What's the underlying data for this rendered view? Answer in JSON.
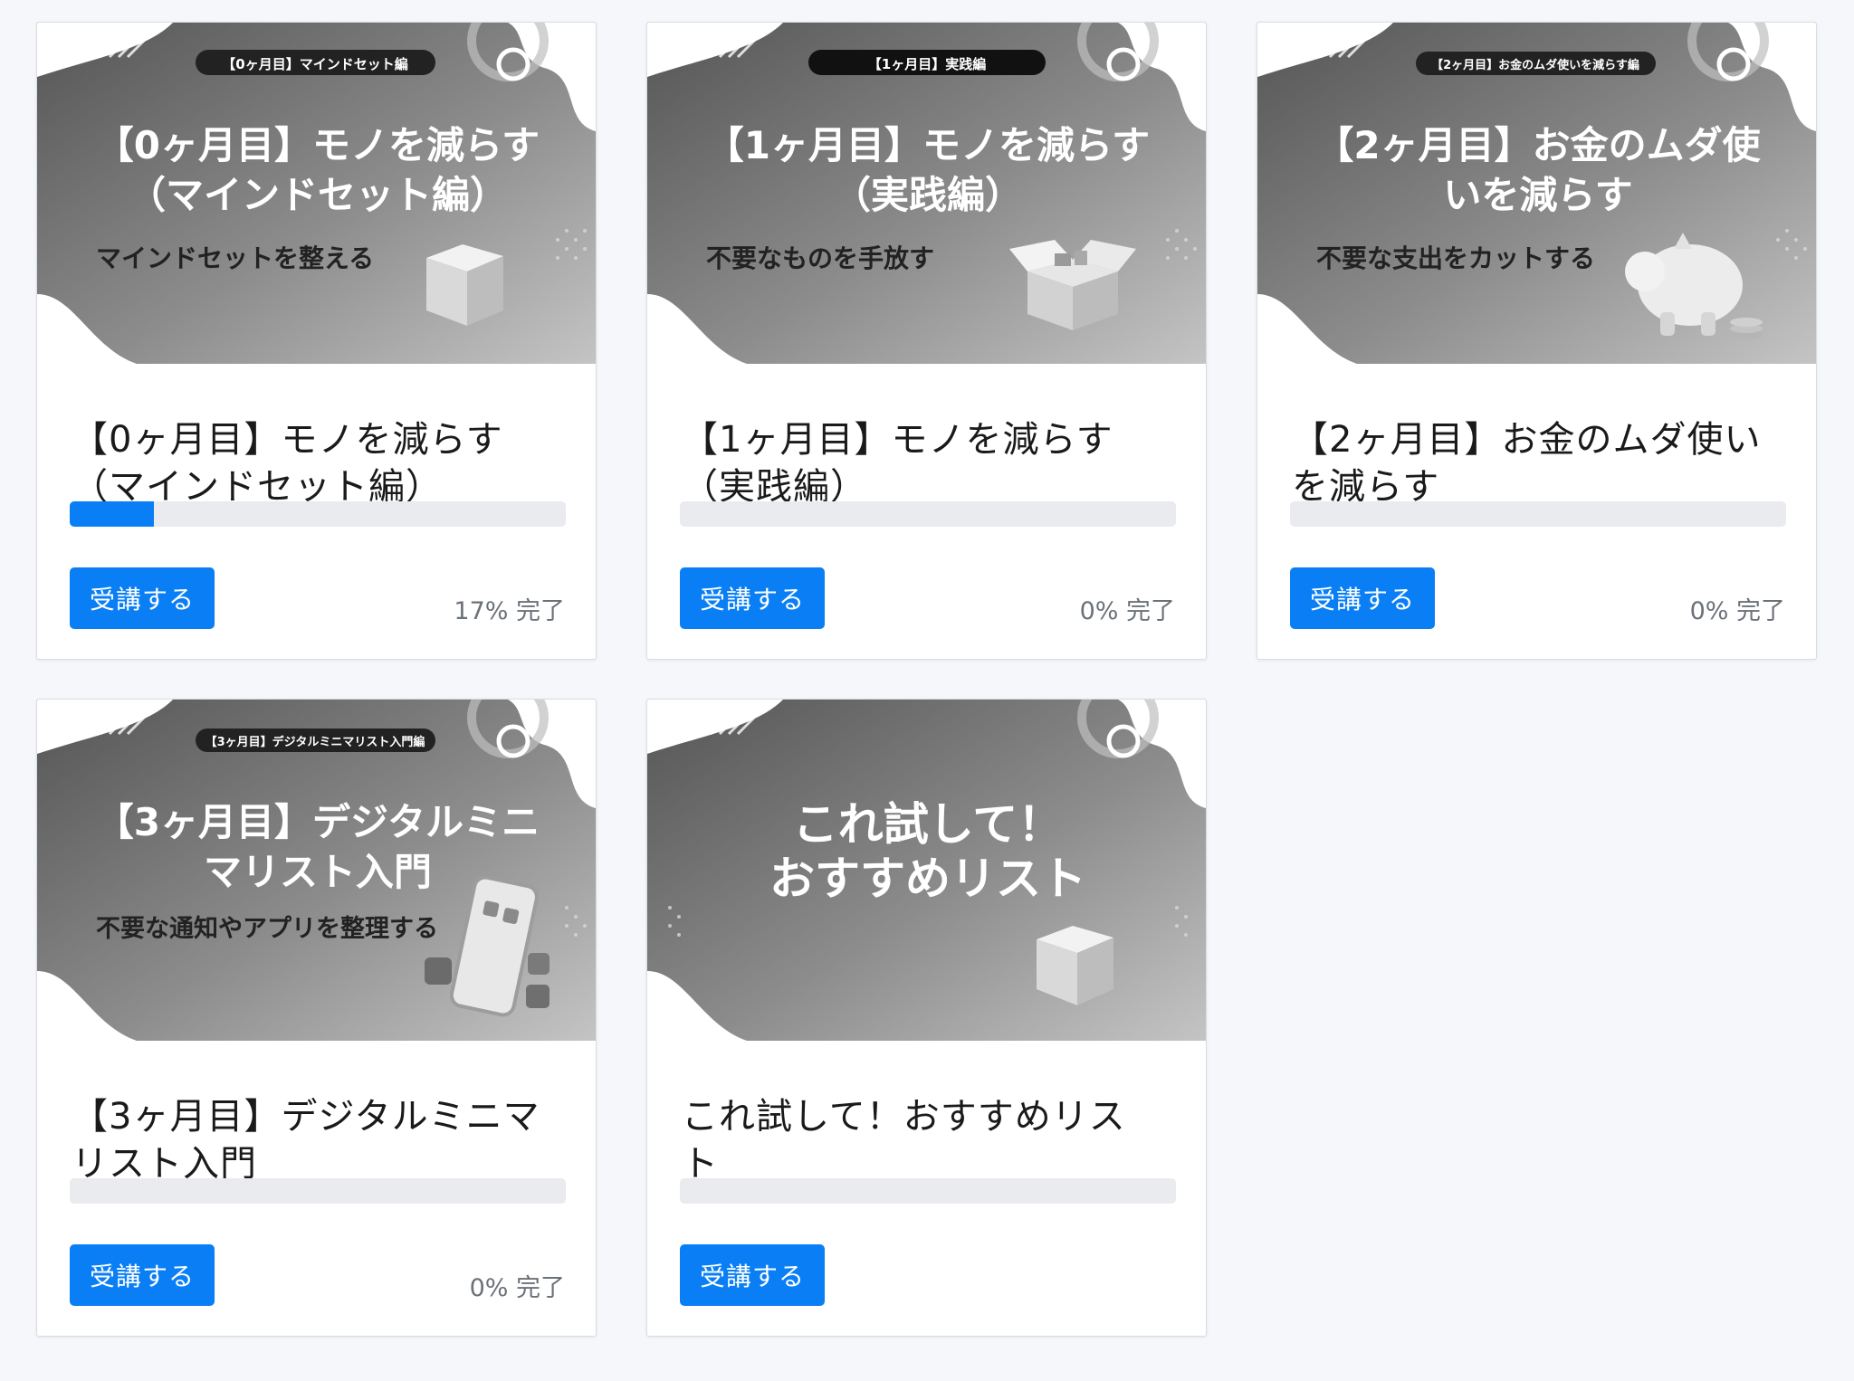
{
  "courses": [
    {
      "thumb": {
        "pill": "【0ヶ月目】マインドセット編",
        "line1": "【0ヶ月目】モノを減らす",
        "line2": "（マインドセット編）",
        "sub": "マインドセットを整える",
        "object": "cube-icon"
      },
      "title_line1": "【0ヶ月目】モノを減らす",
      "title_line2": "（マインドセット編）",
      "progress": 0.17,
      "button_label": "受講する",
      "percent_text": "17% 完了"
    },
    {
      "thumb": {
        "pill": "【1ヶ月目】実践編",
        "line1": "【1ヶ月目】モノを減らす",
        "line2": "（実践編）",
        "sub": "不要なものを手放す",
        "object": "open-box-icon"
      },
      "title_line1": "【1ヶ月目】モノを減らす",
      "title_line2": "（実践編）",
      "progress": 0,
      "button_label": "受講する",
      "percent_text": "0% 完了"
    },
    {
      "thumb": {
        "pill": "【2ヶ月目】お金のムダ使いを減らす編",
        "line1": "【2ヶ月目】お金のムダ使",
        "line2": "いを減らす",
        "sub": "不要な支出をカットする",
        "object": "piggy-bank-icon"
      },
      "title_line1": "【2ヶ月目】お金のムダ使い",
      "title_line2": "を減らす",
      "progress": 0,
      "button_label": "受講する",
      "percent_text": "0% 完了"
    },
    {
      "thumb": {
        "pill": "【3ヶ月目】デジタルミニマリスト入門編",
        "line1": "【3ヶ月目】デジタルミニ",
        "line2": "マリスト入門",
        "sub": "不要な通知やアプリを整理する",
        "object": "smartphone-icon"
      },
      "title_line1": "【3ヶ月目】デジタルミニマ",
      "title_line2": "リスト入門",
      "progress": 0,
      "button_label": "受講する",
      "percent_text": "0% 完了"
    },
    {
      "thumb": {
        "pill": "",
        "line1": "これ試して！",
        "line2": "おすすめリスト",
        "sub": "",
        "object": "cube-icon"
      },
      "title_line1": "これ試して！おすすめリス",
      "title_line2": "ト",
      "progress": 0,
      "button_label": "受講する",
      "percent_text": ""
    }
  ],
  "colors": {
    "accent": "#0a7ff5",
    "track": "#e9ebef",
    "page_bg": "#f5f7fa"
  }
}
